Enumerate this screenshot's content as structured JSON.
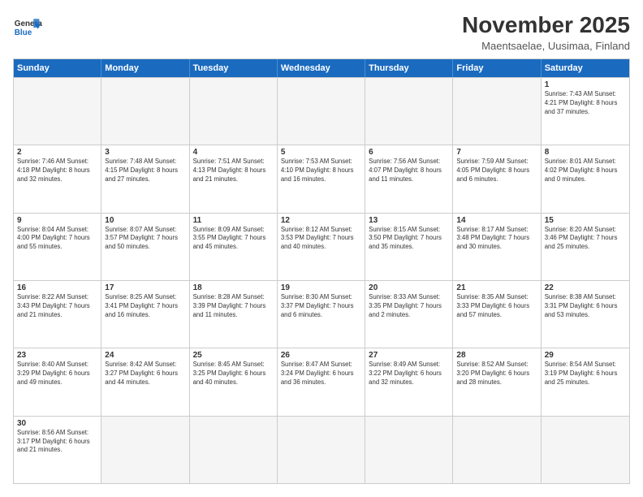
{
  "header": {
    "logo_general": "General",
    "logo_blue": "Blue",
    "month_title": "November 2025",
    "subtitle": "Maentsaelae, Uusimaa, Finland"
  },
  "weekdays": [
    "Sunday",
    "Monday",
    "Tuesday",
    "Wednesday",
    "Thursday",
    "Friday",
    "Saturday"
  ],
  "weeks": [
    [
      {
        "day": "",
        "info": "",
        "empty": true
      },
      {
        "day": "",
        "info": "",
        "empty": true
      },
      {
        "day": "",
        "info": "",
        "empty": true
      },
      {
        "day": "",
        "info": "",
        "empty": true
      },
      {
        "day": "",
        "info": "",
        "empty": true
      },
      {
        "day": "",
        "info": "",
        "empty": true
      },
      {
        "day": "1",
        "info": "Sunrise: 7:43 AM\nSunset: 4:21 PM\nDaylight: 8 hours\nand 37 minutes."
      }
    ],
    [
      {
        "day": "2",
        "info": "Sunrise: 7:46 AM\nSunset: 4:18 PM\nDaylight: 8 hours\nand 32 minutes."
      },
      {
        "day": "3",
        "info": "Sunrise: 7:48 AM\nSunset: 4:15 PM\nDaylight: 8 hours\nand 27 minutes."
      },
      {
        "day": "4",
        "info": "Sunrise: 7:51 AM\nSunset: 4:13 PM\nDaylight: 8 hours\nand 21 minutes."
      },
      {
        "day": "5",
        "info": "Sunrise: 7:53 AM\nSunset: 4:10 PM\nDaylight: 8 hours\nand 16 minutes."
      },
      {
        "day": "6",
        "info": "Sunrise: 7:56 AM\nSunset: 4:07 PM\nDaylight: 8 hours\nand 11 minutes."
      },
      {
        "day": "7",
        "info": "Sunrise: 7:59 AM\nSunset: 4:05 PM\nDaylight: 8 hours\nand 6 minutes."
      },
      {
        "day": "8",
        "info": "Sunrise: 8:01 AM\nSunset: 4:02 PM\nDaylight: 8 hours\nand 0 minutes."
      }
    ],
    [
      {
        "day": "9",
        "info": "Sunrise: 8:04 AM\nSunset: 4:00 PM\nDaylight: 7 hours\nand 55 minutes."
      },
      {
        "day": "10",
        "info": "Sunrise: 8:07 AM\nSunset: 3:57 PM\nDaylight: 7 hours\nand 50 minutes."
      },
      {
        "day": "11",
        "info": "Sunrise: 8:09 AM\nSunset: 3:55 PM\nDaylight: 7 hours\nand 45 minutes."
      },
      {
        "day": "12",
        "info": "Sunrise: 8:12 AM\nSunset: 3:53 PM\nDaylight: 7 hours\nand 40 minutes."
      },
      {
        "day": "13",
        "info": "Sunrise: 8:15 AM\nSunset: 3:50 PM\nDaylight: 7 hours\nand 35 minutes."
      },
      {
        "day": "14",
        "info": "Sunrise: 8:17 AM\nSunset: 3:48 PM\nDaylight: 7 hours\nand 30 minutes."
      },
      {
        "day": "15",
        "info": "Sunrise: 8:20 AM\nSunset: 3:46 PM\nDaylight: 7 hours\nand 25 minutes."
      }
    ],
    [
      {
        "day": "16",
        "info": "Sunrise: 8:22 AM\nSunset: 3:43 PM\nDaylight: 7 hours\nand 21 minutes."
      },
      {
        "day": "17",
        "info": "Sunrise: 8:25 AM\nSunset: 3:41 PM\nDaylight: 7 hours\nand 16 minutes."
      },
      {
        "day": "18",
        "info": "Sunrise: 8:28 AM\nSunset: 3:39 PM\nDaylight: 7 hours\nand 11 minutes."
      },
      {
        "day": "19",
        "info": "Sunrise: 8:30 AM\nSunset: 3:37 PM\nDaylight: 7 hours\nand 6 minutes."
      },
      {
        "day": "20",
        "info": "Sunrise: 8:33 AM\nSunset: 3:35 PM\nDaylight: 7 hours\nand 2 minutes."
      },
      {
        "day": "21",
        "info": "Sunrise: 8:35 AM\nSunset: 3:33 PM\nDaylight: 6 hours\nand 57 minutes."
      },
      {
        "day": "22",
        "info": "Sunrise: 8:38 AM\nSunset: 3:31 PM\nDaylight: 6 hours\nand 53 minutes."
      }
    ],
    [
      {
        "day": "23",
        "info": "Sunrise: 8:40 AM\nSunset: 3:29 PM\nDaylight: 6 hours\nand 49 minutes."
      },
      {
        "day": "24",
        "info": "Sunrise: 8:42 AM\nSunset: 3:27 PM\nDaylight: 6 hours\nand 44 minutes."
      },
      {
        "day": "25",
        "info": "Sunrise: 8:45 AM\nSunset: 3:25 PM\nDaylight: 6 hours\nand 40 minutes."
      },
      {
        "day": "26",
        "info": "Sunrise: 8:47 AM\nSunset: 3:24 PM\nDaylight: 6 hours\nand 36 minutes."
      },
      {
        "day": "27",
        "info": "Sunrise: 8:49 AM\nSunset: 3:22 PM\nDaylight: 6 hours\nand 32 minutes."
      },
      {
        "day": "28",
        "info": "Sunrise: 8:52 AM\nSunset: 3:20 PM\nDaylight: 6 hours\nand 28 minutes."
      },
      {
        "day": "29",
        "info": "Sunrise: 8:54 AM\nSunset: 3:19 PM\nDaylight: 6 hours\nand 25 minutes."
      }
    ],
    [
      {
        "day": "30",
        "info": "Sunrise: 8:56 AM\nSunset: 3:17 PM\nDaylight: 6 hours\nand 21 minutes."
      },
      {
        "day": "",
        "info": "",
        "empty": true
      },
      {
        "day": "",
        "info": "",
        "empty": true
      },
      {
        "day": "",
        "info": "",
        "empty": true
      },
      {
        "day": "",
        "info": "",
        "empty": true
      },
      {
        "day": "",
        "info": "",
        "empty": true
      },
      {
        "day": "",
        "info": "",
        "empty": true
      }
    ]
  ]
}
